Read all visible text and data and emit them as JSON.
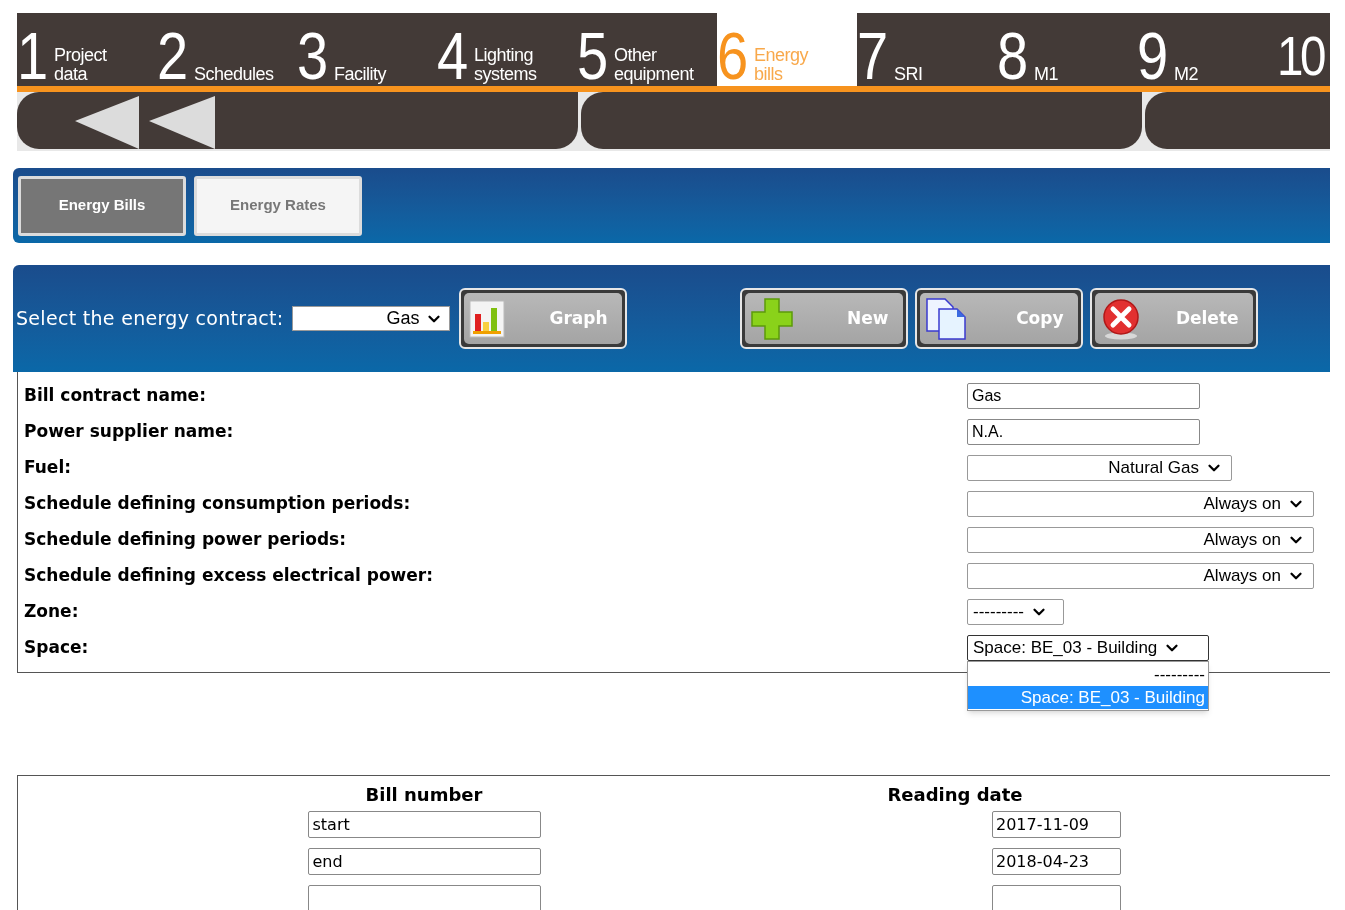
{
  "steps": [
    {
      "number": "1",
      "label": "Project data",
      "selected": false
    },
    {
      "number": "2",
      "label": "Schedules",
      "selected": false
    },
    {
      "number": "3",
      "label": "Facility",
      "selected": false
    },
    {
      "number": "4",
      "label": "Lighting systems",
      "selected": false
    },
    {
      "number": "5",
      "label": "Other equipment",
      "selected": false
    },
    {
      "number": "6",
      "label": "Energy bills",
      "selected": true
    },
    {
      "number": "7",
      "label": "SRI",
      "selected": false
    },
    {
      "number": "8",
      "label": "M1",
      "selected": false
    },
    {
      "number": "9",
      "label": "M2",
      "selected": false
    },
    {
      "number": "10",
      "selected": false
    }
  ],
  "tabs": [
    {
      "label": "Energy Bills",
      "selected": true
    },
    {
      "label": "Energy Rates",
      "selected": false
    }
  ],
  "toolbar": {
    "contract_label": "Select the energy contract:",
    "contract_value": "Gas",
    "buttons": [
      {
        "kind": "graph",
        "label": "Graph"
      },
      {
        "kind": "new",
        "label": "New"
      },
      {
        "kind": "copy",
        "label": "Copy"
      },
      {
        "kind": "delete",
        "label": "Delete"
      }
    ]
  },
  "form": [
    {
      "label": "Bill contract name:",
      "kind": "text",
      "value": "Gas"
    },
    {
      "label": "Power supplier name:",
      "kind": "text",
      "value": "N.A."
    },
    {
      "label": "Fuel:",
      "kind": "select",
      "value": "Natural Gas"
    },
    {
      "label": "Schedule defining consumption periods:",
      "kind": "select",
      "value": "Always on"
    },
    {
      "label": "Schedule defining power periods:",
      "kind": "select",
      "value": "Always on"
    },
    {
      "label": "Schedule defining excess electrical power:",
      "kind": "select",
      "value": "Always on"
    },
    {
      "label": "Zone:",
      "kind": "select",
      "value": "---------"
    },
    {
      "label": "Space:",
      "kind": "select",
      "value": "Space: BE_03 - Building",
      "expanded": true,
      "options": [
        {
          "label": "---------",
          "selected": false
        },
        {
          "label": "Space: BE_03 - Building",
          "selected": true
        }
      ]
    }
  ],
  "table": {
    "columns": [
      "Bill number",
      "Reading date"
    ],
    "rows": [
      {
        "bill_number": "start",
        "reading_date": "2017-11-09"
      },
      {
        "bill_number": "end",
        "reading_date": "2018-04-23"
      },
      {}
    ]
  }
}
